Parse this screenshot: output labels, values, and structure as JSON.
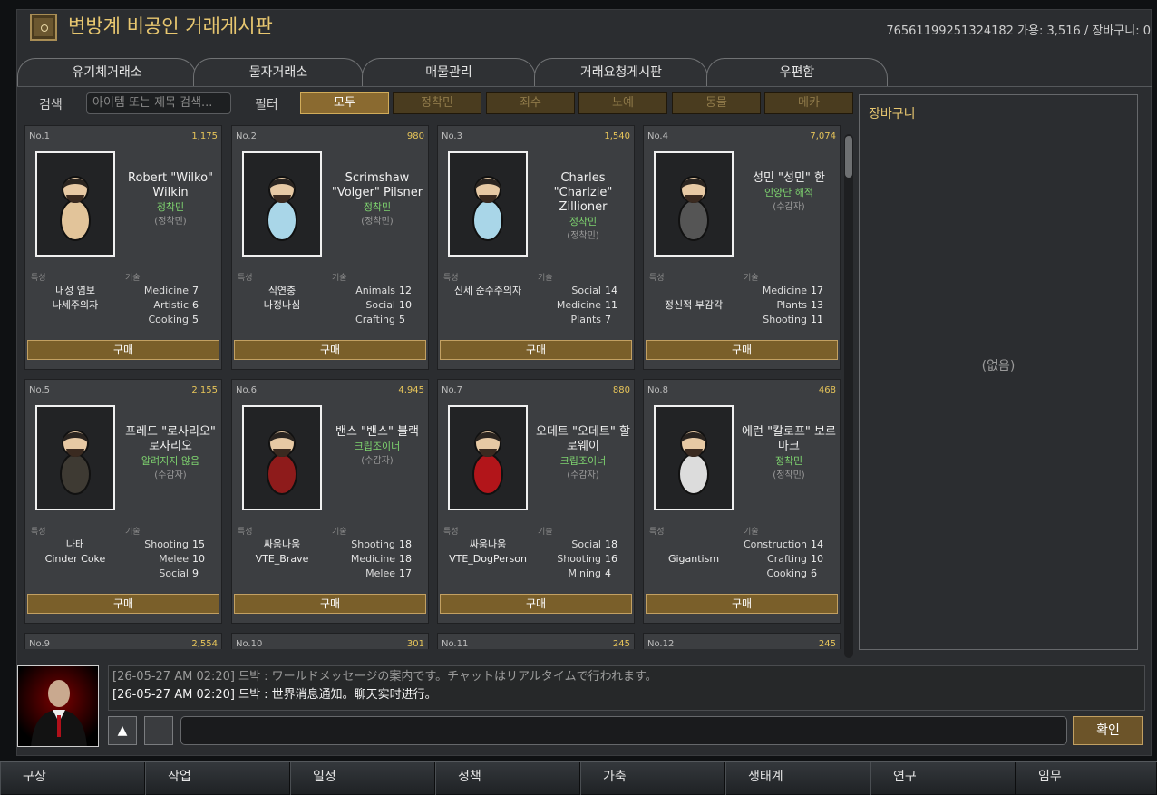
{
  "window": {
    "title": "변방계 비공인 거래게시판",
    "user_info": "76561199251324182   가용: 3,516 / 장바구니: 0"
  },
  "tabs": [
    {
      "label": "유기체거래소"
    },
    {
      "label": "물자거래소"
    },
    {
      "label": "매물관리"
    },
    {
      "label": "거래요청게시판"
    },
    {
      "label": "우편함"
    }
  ],
  "search": {
    "label": "검색",
    "placeholder": "아이템 또는 제목 검색..."
  },
  "filter": {
    "label": "필터",
    "options": [
      "모두",
      "정착민",
      "죄수",
      "노예",
      "동물",
      "메카"
    ],
    "selected": "모두"
  },
  "card_headers": {
    "traits": "특성",
    "skills": "기술"
  },
  "buy_label": "구매",
  "listings": [
    {
      "no": "No.1",
      "price": "1,175",
      "name": "Robert \"Wilko\" Wilkin",
      "faction": "정착민",
      "role": "(정착민)",
      "traits": [
        "내성 염보",
        "나세주의자"
      ],
      "skills": [
        {
          "n": "Medicine",
          "v": "7"
        },
        {
          "n": "Artistic",
          "v": "6"
        },
        {
          "n": "Cooking",
          "v": "5"
        }
      ]
    },
    {
      "no": "No.2",
      "price": "980",
      "name": "Scrimshaw \"Volger\" Pilsner",
      "faction": "정착민",
      "role": "(정착민)",
      "traits": [
        "식연충",
        "나정나심"
      ],
      "skills": [
        {
          "n": "Animals",
          "v": "12"
        },
        {
          "n": "Social",
          "v": "10"
        },
        {
          "n": "Crafting",
          "v": "5"
        }
      ]
    },
    {
      "no": "No.3",
      "price": "1,540",
      "name": "Charles \"Charlzie\" Zillioner",
      "faction": "정착민",
      "role": "(정착민)",
      "traits": [
        "신세 순수주의자"
      ],
      "skills": [
        {
          "n": "Social",
          "v": "14"
        },
        {
          "n": "Medicine",
          "v": "11"
        },
        {
          "n": "Plants",
          "v": "7"
        }
      ]
    },
    {
      "no": "No.4",
      "price": "7,074",
      "name": "성민 \"성민\" 한",
      "faction": "인양단 해적",
      "role": "(수감자)",
      "traits": [
        "",
        "정신적 부감각"
      ],
      "skills": [
        {
          "n": "Medicine",
          "v": "17"
        },
        {
          "n": "Plants",
          "v": "13"
        },
        {
          "n": "Shooting",
          "v": "11"
        }
      ]
    },
    {
      "no": "No.5",
      "price": "2,155",
      "name": "프레드 \"로사리오\" 로사리오",
      "faction": "알려지지 않음",
      "role": "(수감자)",
      "traits": [
        "나태",
        "Cinder Coke"
      ],
      "skills": [
        {
          "n": "Shooting",
          "v": "15"
        },
        {
          "n": "Melee",
          "v": "10"
        },
        {
          "n": "Social",
          "v": "9"
        }
      ]
    },
    {
      "no": "No.6",
      "price": "4,945",
      "name": "밴스 \"밴스\" 블랙",
      "faction": "크립조이너",
      "role": "(수감자)",
      "traits": [
        "싸움나움",
        "VTE_Brave"
      ],
      "skills": [
        {
          "n": "Shooting",
          "v": "18"
        },
        {
          "n": "Medicine",
          "v": "18"
        },
        {
          "n": "Melee",
          "v": "17"
        }
      ]
    },
    {
      "no": "No.7",
      "price": "880",
      "name": "오데트 \"오데트\" 할로웨이",
      "faction": "크립조이너",
      "role": "(수감자)",
      "traits": [
        "싸움나움",
        "VTE_DogPerson"
      ],
      "skills": [
        {
          "n": "Social",
          "v": "18"
        },
        {
          "n": "Shooting",
          "v": "16"
        },
        {
          "n": "Mining",
          "v": "4"
        }
      ]
    },
    {
      "no": "No.8",
      "price": "468",
      "name": "에런 \"칼로프\" 보르마크",
      "faction": "정착민",
      "role": "(정착민)",
      "traits": [
        "",
        "Gigantism"
      ],
      "skills": [
        {
          "n": "Construction",
          "v": "14"
        },
        {
          "n": "Crafting",
          "v": "10"
        },
        {
          "n": "Cooking",
          "v": "6"
        }
      ]
    }
  ],
  "more_listings": [
    {
      "no": "No.9",
      "price": "2,554"
    },
    {
      "no": "No.10",
      "price": "301"
    },
    {
      "no": "No.11",
      "price": "245"
    },
    {
      "no": "No.12",
      "price": "245"
    }
  ],
  "cart": {
    "title": "장바구니",
    "empty_text": "(없음)"
  },
  "chat": {
    "messages": [
      "[26-05-27 AM 02:20] 드박 : ワールドメッセージの案内です。チャットはリアルタイムで行われます。",
      "[26-05-27 AM 02:20] 드박 : 世界消息通知。聊天实时进行。"
    ],
    "up_button": "▲",
    "confirm": "확인"
  },
  "bottom_bar": [
    "구상",
    "작업",
    "일정",
    "정책",
    "가축",
    "생태계",
    "연구",
    "임무"
  ],
  "colors": {
    "accent": "#e8c770",
    "faction_green": "#7ed36f",
    "buy_button": "#7a5f2a"
  },
  "portrait_colors": [
    "#e2c49a",
    "#a9d6e8",
    "#a9d6e8",
    "#555555",
    "#3e3a33",
    "#8e1b1b",
    "#b2151a",
    "#dcdcdc"
  ]
}
